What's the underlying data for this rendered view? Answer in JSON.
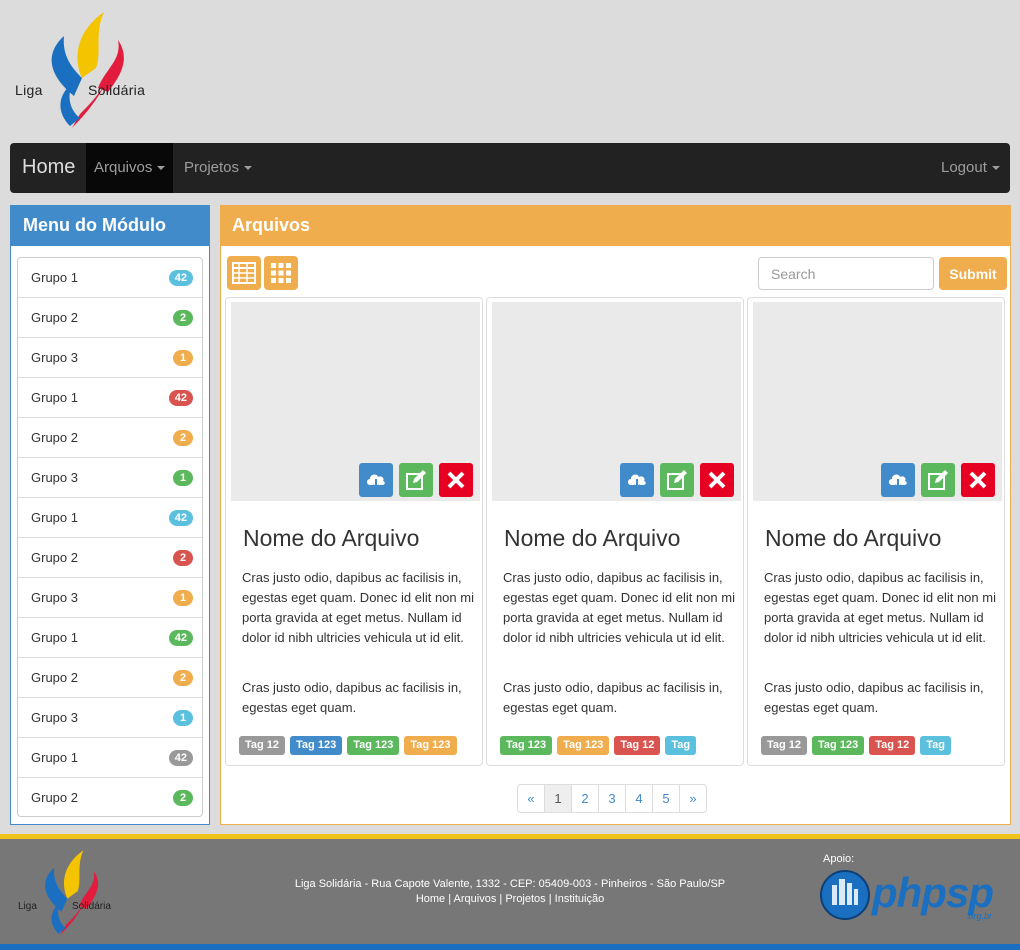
{
  "brand": {
    "logo_left": "Liga",
    "logo_right": "Solidária"
  },
  "navbar": {
    "home": "Home",
    "items": [
      "Arquivos",
      "Projetos"
    ],
    "logout": "Logout"
  },
  "sidebar": {
    "title": "Menu do Módulo",
    "items": [
      {
        "label": "Grupo 1",
        "count": "42",
        "color": "#5bc0de"
      },
      {
        "label": "Grupo 2",
        "count": "2",
        "color": "#5cb85c"
      },
      {
        "label": "Grupo 3",
        "count": "1",
        "color": "#f0ad4e"
      },
      {
        "label": "Grupo 1",
        "count": "42",
        "color": "#d9534f"
      },
      {
        "label": "Grupo 2",
        "count": "2",
        "color": "#f0ad4e"
      },
      {
        "label": "Grupo 3",
        "count": "1",
        "color": "#5cb85c"
      },
      {
        "label": "Grupo 1",
        "count": "42",
        "color": "#5bc0de"
      },
      {
        "label": "Grupo 2",
        "count": "2",
        "color": "#d9534f"
      },
      {
        "label": "Grupo 3",
        "count": "1",
        "color": "#f0ad4e"
      },
      {
        "label": "Grupo 1",
        "count": "42",
        "color": "#5cb85c"
      },
      {
        "label": "Grupo 2",
        "count": "2",
        "color": "#f0ad4e"
      },
      {
        "label": "Grupo 3",
        "count": "1",
        "color": "#5bc0de"
      },
      {
        "label": "Grupo 1",
        "count": "42",
        "color": "#999999"
      },
      {
        "label": "Grupo 2",
        "count": "2",
        "color": "#5cb85c"
      }
    ]
  },
  "main": {
    "title": "Arquivos",
    "search_placeholder": "Search",
    "submit_label": "Submit",
    "cards": [
      {
        "title": "Nome do Arquivo",
        "text1": "Cras justo odio, dapibus ac facilisis in, egestas eget quam. Donec id elit non mi porta gravida at eget metus. Nullam id dolor id nibh ultricies vehicula ut id elit.",
        "text2": "Cras justo odio, dapibus ac facilisis in, egestas eget quam.",
        "tags": [
          {
            "label": "Tag 12",
            "color": "#999999"
          },
          {
            "label": "Tag 123",
            "color": "#428bca"
          },
          {
            "label": "Tag 123",
            "color": "#5cb85c"
          },
          {
            "label": "Tag 123",
            "color": "#f0ad4e"
          }
        ]
      },
      {
        "title": "Nome do Arquivo",
        "text1": "Cras justo odio, dapibus ac facilisis in, egestas eget quam. Donec id elit non mi porta gravida at eget metus. Nullam id dolor id nibh ultricies vehicula ut id elit.",
        "text2": "Cras justo odio, dapibus ac facilisis in, egestas eget quam.",
        "tags": [
          {
            "label": "Tag 123",
            "color": "#5cb85c"
          },
          {
            "label": "Tag 123",
            "color": "#f0ad4e"
          },
          {
            "label": "Tag 12",
            "color": "#d9534f"
          },
          {
            "label": "Tag",
            "color": "#5bc0de"
          }
        ]
      },
      {
        "title": "Nome do Arquivo",
        "text1": "Cras justo odio, dapibus ac facilisis in, egestas eget quam. Donec id elit non mi porta gravida at eget metus. Nullam id dolor id nibh ultricies vehicula ut id elit.",
        "text2": "Cras justo odio, dapibus ac facilisis in, egestas eget quam.",
        "tags": [
          {
            "label": "Tag 12",
            "color": "#999999"
          },
          {
            "label": "Tag 123",
            "color": "#5cb85c"
          },
          {
            "label": "Tag 12",
            "color": "#d9534f"
          },
          {
            "label": "Tag",
            "color": "#5bc0de"
          }
        ]
      }
    ],
    "pagination": [
      "«",
      "1",
      "2",
      "3",
      "4",
      "5",
      "»"
    ],
    "pagination_active": "1"
  },
  "footer": {
    "address": "Liga Solidária -  Rua Capote Valente, 1332 - CEP: 05409-003 - Pinheiros - São Paulo/SP",
    "links": [
      "Home",
      "Arquivos",
      "Projetos",
      "Instituição"
    ],
    "apoio": "Apoio:",
    "sponsor": "phpsp",
    "sponsor_domain": ".org.br"
  },
  "colors": {
    "primary": "#428bca",
    "warning": "#f0ad4e",
    "success": "#5cb85c",
    "danger": "#d9534f",
    "info": "#5bc0de",
    "download_button": "#428bca",
    "edit_button": "#5cb85c",
    "delete_button": "#e60022"
  }
}
